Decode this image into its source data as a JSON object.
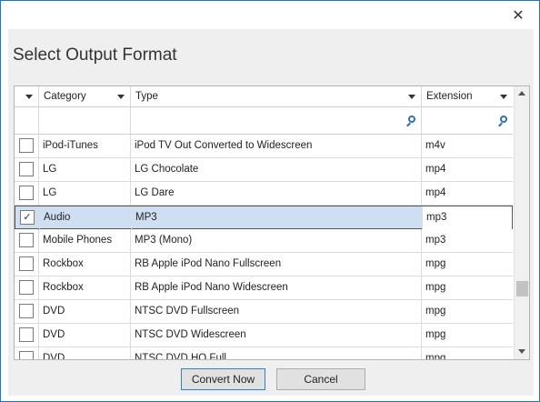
{
  "dialog": {
    "title": "Select Output Format",
    "close_glyph": "✕"
  },
  "grid": {
    "columns": [
      {
        "label": ""
      },
      {
        "label": "Category"
      },
      {
        "label": "Type"
      },
      {
        "label": "Extension"
      }
    ],
    "rows": [
      {
        "checked": false,
        "category": "iPod-iTunes",
        "type": "iPod TV Out Converted to Widescreen",
        "extension": "m4v"
      },
      {
        "checked": false,
        "category": "LG",
        "type": "LG Chocolate",
        "extension": "mp4"
      },
      {
        "checked": false,
        "category": "LG",
        "type": "LG Dare",
        "extension": "mp4"
      },
      {
        "checked": true,
        "category": "Audio",
        "type": "MP3",
        "extension": "mp3",
        "selected": true
      },
      {
        "checked": false,
        "category": "Mobile Phones",
        "type": "MP3 (Mono)",
        "extension": "mp3"
      },
      {
        "checked": false,
        "category": "Rockbox",
        "type": "RB Apple iPod Nano Fullscreen",
        "extension": "mpg"
      },
      {
        "checked": false,
        "category": "Rockbox",
        "type": "RB Apple iPod Nano Widescreen",
        "extension": "mpg"
      },
      {
        "checked": false,
        "category": "DVD",
        "type": "NTSC DVD Fullscreen",
        "extension": "mpg"
      },
      {
        "checked": false,
        "category": "DVD",
        "type": "NTSC DVD Widescreen",
        "extension": "mpg"
      },
      {
        "checked": false,
        "category": "DVD",
        "type": "NTSC DVD HQ Full",
        "extension": "mpg"
      }
    ]
  },
  "buttons": {
    "convert": "Convert Now",
    "cancel": "Cancel"
  },
  "icons": {
    "close": "close-icon",
    "filter": "magnifier-icon",
    "dropdown": "chevron-down-icon"
  },
  "colors": {
    "accent": "#1e74d0",
    "selection": "#cfdff2"
  }
}
